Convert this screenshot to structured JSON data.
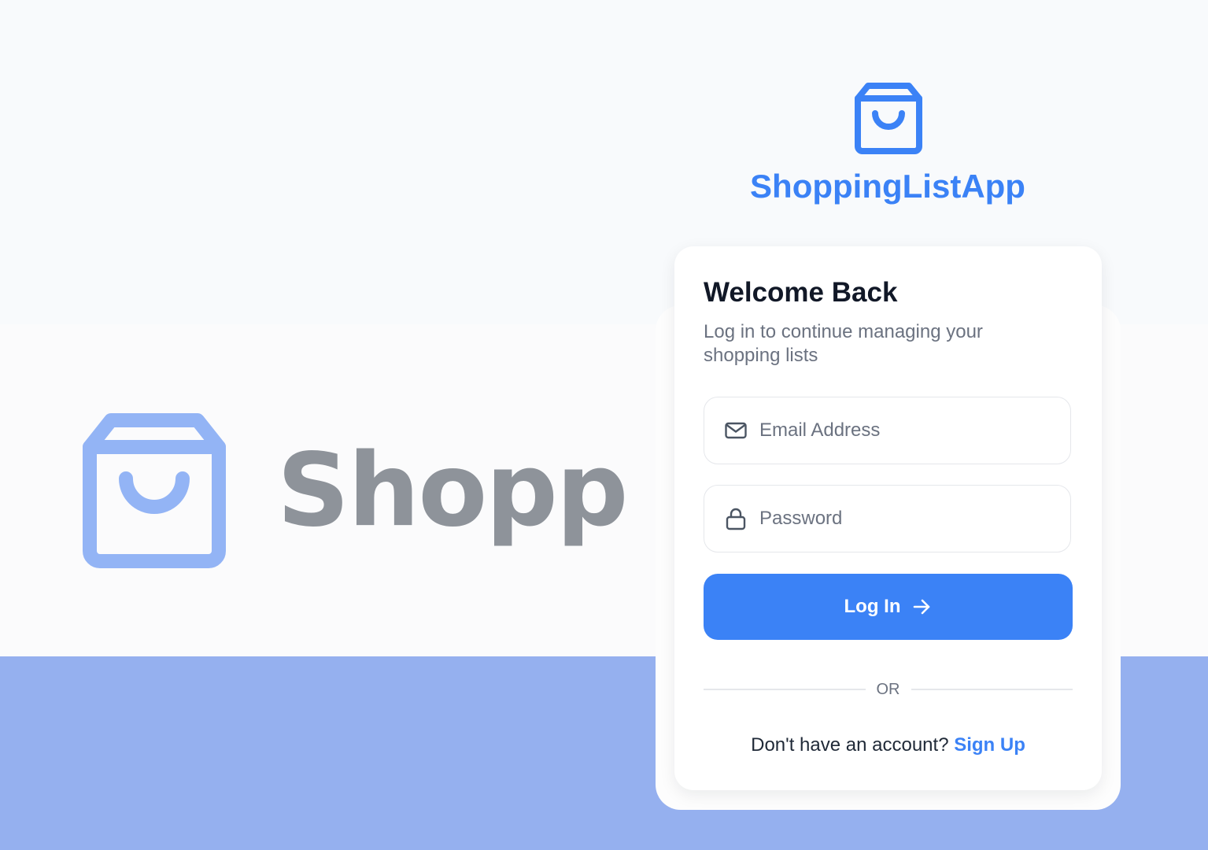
{
  "hero": {
    "wordmark": "Shopp",
    "icon": "shopping-bag-icon"
  },
  "brand": {
    "app_name": "ShoppingListApp",
    "icon": "shopping-bag-icon"
  },
  "login_card": {
    "title": "Welcome Back",
    "subtitle": "Log in to continue managing your shopping lists",
    "email": {
      "placeholder": "Email Address",
      "value": "",
      "icon": "mail-icon"
    },
    "password": {
      "placeholder": "Password",
      "value": "",
      "icon": "lock-icon"
    },
    "submit_label": "Log In",
    "submit_icon": "arrow-right-icon",
    "divider_text": "OR",
    "signup_prompt": "Don't have an account?",
    "signup_link": "Sign Up"
  },
  "colors": {
    "primary": "#3b82f6",
    "hero_icon": "#93b4f5",
    "hero_text": "#8e939a",
    "lower_band": "#95b0ef"
  }
}
